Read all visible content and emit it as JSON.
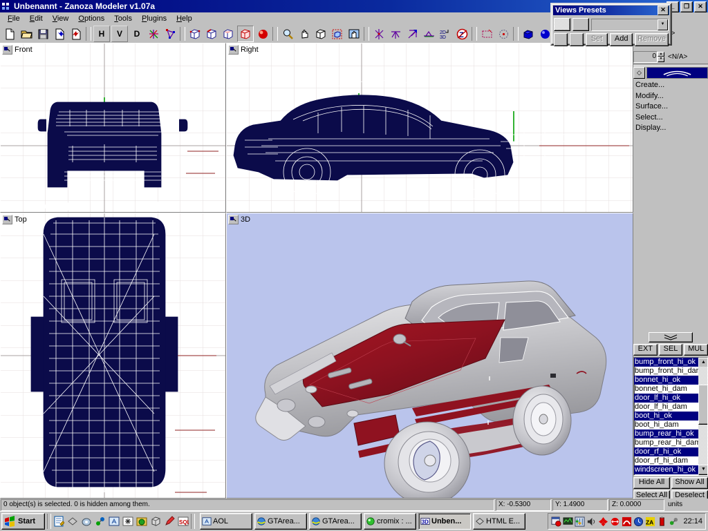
{
  "window": {
    "title": "Unbenannt - Zanoza Modeler v1.07a",
    "icon": "zmodeler-logo-icon",
    "controls": [
      {
        "name": "minimize-button",
        "glyph": "_"
      },
      {
        "name": "restore-button",
        "glyph": "❐"
      },
      {
        "name": "close-button",
        "glyph": "✕"
      }
    ]
  },
  "menubar": {
    "items": [
      {
        "label": "File",
        "accel": "F"
      },
      {
        "label": "Edit",
        "accel": "E"
      },
      {
        "label": "View",
        "accel": "V"
      },
      {
        "label": "Options",
        "accel": "O"
      },
      {
        "label": "Tools",
        "accel": "T"
      },
      {
        "label": "Plugins",
        "accel": "P"
      },
      {
        "label": "Help",
        "accel": "H"
      }
    ]
  },
  "toolbar": {
    "groups": [
      {
        "name": "file-group",
        "buttons": [
          {
            "name": "new-file-icon",
            "kind": "page"
          },
          {
            "name": "open-file-icon",
            "kind": "folder"
          },
          {
            "name": "save-file-icon",
            "kind": "disk"
          },
          {
            "name": "import-icon",
            "kind": "page-blue-arrow"
          },
          {
            "name": "export-icon",
            "kind": "page-red-arrow"
          }
        ]
      },
      {
        "name": "axis-group",
        "buttons": [
          {
            "name": "horizontal-lock-button",
            "kind": "letter",
            "label": "H"
          },
          {
            "name": "vertical-lock-button",
            "kind": "letter",
            "label": "V"
          },
          {
            "name": "depth-lock-button",
            "kind": "letter",
            "label": "D"
          },
          {
            "name": "vertices-icon",
            "kind": "vertices"
          },
          {
            "name": "polygons-icon",
            "kind": "polys"
          }
        ]
      },
      {
        "name": "selection-mode-group",
        "buttons": [
          {
            "name": "select-vertices-cube-icon",
            "kind": "cube-v"
          },
          {
            "name": "select-edges-cube-icon",
            "kind": "cube-e"
          },
          {
            "name": "select-faces-cube-icon",
            "kind": "cube-f"
          },
          {
            "name": "select-objects-cube-icon",
            "kind": "cube-o",
            "pressed": true
          },
          {
            "name": "material-editor-icon",
            "kind": "sphere-red"
          }
        ]
      },
      {
        "name": "view-tools-group",
        "buttons": [
          {
            "name": "zoom-tool-icon",
            "kind": "magnifier"
          },
          {
            "name": "pan-tool-icon",
            "kind": "hand"
          },
          {
            "name": "rotate-view-icon",
            "kind": "cube-wire"
          },
          {
            "name": "zoom-window-icon",
            "kind": "cube-marquee"
          },
          {
            "name": "zoom-extents-icon",
            "kind": "hand-page"
          }
        ]
      },
      {
        "name": "transform-group",
        "buttons": [
          {
            "name": "move-tool-icon",
            "kind": "move"
          },
          {
            "name": "rotate-tool-icon",
            "kind": "rot"
          },
          {
            "name": "scale-tool-icon",
            "kind": "scale"
          },
          {
            "name": "mirror-tool-icon",
            "kind": "mirror"
          },
          {
            "name": "2d-3d-toggle-icon",
            "kind": "2d3d"
          },
          {
            "name": "zmodeler-logo-icon",
            "kind": "zlogo"
          }
        ]
      },
      {
        "name": "marquee-group",
        "buttons": [
          {
            "name": "rect-select-icon",
            "kind": "marquee"
          },
          {
            "name": "circle-select-icon",
            "kind": "circlesel"
          }
        ]
      },
      {
        "name": "primitives-group",
        "buttons": [
          {
            "name": "create-box-icon",
            "kind": "box-blue"
          },
          {
            "name": "create-sphere-icon",
            "kind": "sphere-blue"
          },
          {
            "name": "create-cylinder-icon",
            "kind": "cyl-blue"
          },
          {
            "name": "create-extra-icon",
            "kind": "extra-blue"
          }
        ]
      }
    ]
  },
  "views_presets": {
    "title": "Views Presets",
    "close_glyph": "✕",
    "combo_value": "",
    "buttons": [
      {
        "name": "set-preset-button",
        "label": "Set",
        "disabled": true
      },
      {
        "name": "add-preset-button",
        "label": "Add",
        "disabled": false
      },
      {
        "name": "remove-preset-button",
        "label": "Remove",
        "disabled": true
      }
    ]
  },
  "viewports": [
    {
      "name": "viewport-front",
      "label": "Front"
    },
    {
      "name": "viewport-right",
      "label": "Right"
    },
    {
      "name": "viewport-top",
      "label": "Top"
    },
    {
      "name": "viewport-3d",
      "label": "3D"
    }
  ],
  "sidepanel": {
    "spin_value": "0",
    "na_top": "<N/A>",
    "na_second": "<N/A>",
    "command_arrow": "◇",
    "menu": [
      {
        "name": "create-menu-item",
        "label": "Create..."
      },
      {
        "name": "modify-menu-item",
        "label": "Modify..."
      },
      {
        "name": "surface-menu-item",
        "label": "Surface..."
      },
      {
        "name": "select-menu-item",
        "label": "Select..."
      },
      {
        "name": "display-menu-item",
        "label": "Display..."
      }
    ],
    "chevron": "≣",
    "mode_buttons": [
      {
        "name": "ext-button",
        "label": "EXT"
      },
      {
        "name": "sel-button",
        "label": "SEL"
      },
      {
        "name": "mul-button",
        "label": "MUL"
      }
    ],
    "object_list": [
      {
        "label": "bump_front_hi_ok",
        "selected": true
      },
      {
        "label": "bump_front_hi_dam",
        "selected": false
      },
      {
        "label": "bonnet_hi_ok",
        "selected": true
      },
      {
        "label": "bonnet_hi_dam",
        "selected": false
      },
      {
        "label": "door_lf_hi_ok",
        "selected": true
      },
      {
        "label": "door_lf_hi_dam",
        "selected": false
      },
      {
        "label": "boot_hi_ok",
        "selected": true
      },
      {
        "label": "boot_hi_dam",
        "selected": false
      },
      {
        "label": "bump_rear_hi_ok",
        "selected": true
      },
      {
        "label": "bump_rear_hi_dam",
        "selected": false
      },
      {
        "label": "door_rf_hi_ok",
        "selected": true
      },
      {
        "label": "door_rf_hi_dam",
        "selected": false
      },
      {
        "label": "windscreen_hi_ok",
        "selected": true
      }
    ],
    "list_buttons": [
      {
        "name": "hide-all-button",
        "label": "Hide All"
      },
      {
        "name": "show-all-button",
        "label": "Show All"
      },
      {
        "name": "select-all-button",
        "label": "Select All"
      },
      {
        "name": "deselect-button",
        "label": "Deselect"
      }
    ]
  },
  "statusbar": {
    "message": "0 object(s) is selected. 0 is hidden among them.",
    "x": "X: -0.5300",
    "y": "Y: 1.4900",
    "z": "Z: 0.0000",
    "units": "units"
  },
  "taskbar": {
    "start_label": "Start",
    "tasks": [
      {
        "name": "taskbar-item-aol",
        "label": "AOL",
        "icon": "aol-icon",
        "active": false
      },
      {
        "name": "taskbar-item-gtarea-1",
        "label": "GTArea...",
        "icon": "ie-icon",
        "active": false
      },
      {
        "name": "taskbar-item-gtarea-2",
        "label": "GTArea...",
        "icon": "ie-icon",
        "active": false
      },
      {
        "name": "taskbar-item-cromix",
        "label": "cromix : ...",
        "icon": "green-orb-icon",
        "active": false
      },
      {
        "name": "taskbar-item-unbenannt",
        "label": "Unben...",
        "icon": "zmodeler-icon",
        "active": true
      },
      {
        "name": "taskbar-item-html-editor",
        "label": "HTML E...",
        "icon": "diamond-icon",
        "active": false
      }
    ],
    "clock": "22:14"
  },
  "colors": {
    "titlebar_start": "#00007b",
    "titlebar_end": "#2a6ad4",
    "face": "#c0c0c0",
    "selection": "#000080",
    "wireframe": "#00004f",
    "viewport_3d_bg": "#bac4ec",
    "car_body": "#c8c8cc",
    "car_stripe": "#8f1220"
  }
}
